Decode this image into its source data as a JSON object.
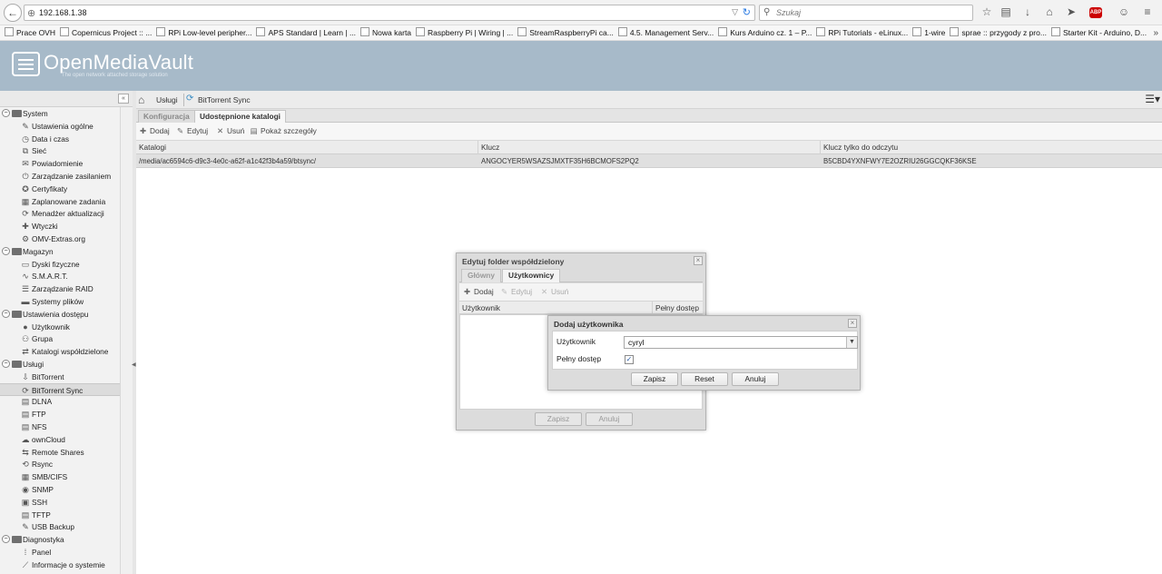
{
  "browser": {
    "url": "192.168.1.38",
    "search_placeholder": "Szukaj",
    "bookmarks": [
      "Prace OVH",
      "Copernicus Project :: ...",
      "RPi Low-level peripher...",
      "APS Standard | Learn | ...",
      "Nowa karta",
      "Raspberry Pi | Wiring | ...",
      "StreamRaspberryPi ca...",
      "4.5. Management Serv...",
      "Kurs Arduino cz. 1 – P...",
      "RPi Tutorials - eLinux...",
      "1-wire",
      "sprae :: przygody z pro...",
      "Starter Kit - Arduino, D..."
    ],
    "abp_label": "ABP"
  },
  "app": {
    "name": "OpenMediaVault",
    "tagline": "The open network attached storage solution"
  },
  "sidebar": {
    "collapse_glyph": "«",
    "nodes": [
      {
        "type": "group",
        "label": "System",
        "icon": "folder-icon"
      },
      {
        "type": "item",
        "label": "Ustawienia ogólne",
        "icon": "wrench-icon",
        "glyph": "✎"
      },
      {
        "type": "item",
        "label": "Data i czas",
        "icon": "clock-icon",
        "glyph": "◷"
      },
      {
        "type": "item",
        "label": "Sieć",
        "icon": "network-icon",
        "glyph": "⧉"
      },
      {
        "type": "item",
        "label": "Powiadomienie",
        "icon": "mail-icon",
        "glyph": "✉"
      },
      {
        "type": "item",
        "label": "Zarządzanie zasilaniem",
        "icon": "power-icon",
        "glyph": "⏻"
      },
      {
        "type": "item",
        "label": "Certyfikaty",
        "icon": "certificate-icon",
        "glyph": "✪"
      },
      {
        "type": "item",
        "label": "Zaplanowane zadania",
        "icon": "calendar-icon",
        "glyph": "▦"
      },
      {
        "type": "item",
        "label": "Menadżer aktualizacji",
        "icon": "update-icon",
        "glyph": "⟳"
      },
      {
        "type": "item",
        "label": "Wtyczki",
        "icon": "plugin-icon",
        "glyph": "✚"
      },
      {
        "type": "item",
        "label": "OMV-Extras.org",
        "icon": "extras-icon",
        "glyph": "⚙"
      },
      {
        "type": "group",
        "label": "Magazyn",
        "icon": "folder-icon"
      },
      {
        "type": "item",
        "label": "Dyski fizyczne",
        "icon": "disk-icon",
        "glyph": "▭"
      },
      {
        "type": "item",
        "label": "S.M.A.R.T.",
        "icon": "smart-icon",
        "glyph": "∿"
      },
      {
        "type": "item",
        "label": "Zarządzanie RAID",
        "icon": "raid-icon",
        "glyph": "☰"
      },
      {
        "type": "item",
        "label": "Systemy plików",
        "icon": "filesystem-icon",
        "glyph": "▬"
      },
      {
        "type": "group",
        "label": "Ustawienia dostępu",
        "icon": "folder-icon"
      },
      {
        "type": "item",
        "label": "Użytkownik",
        "icon": "user-icon",
        "glyph": "●"
      },
      {
        "type": "item",
        "label": "Grupa",
        "icon": "group-icon",
        "glyph": "⚇"
      },
      {
        "type": "item",
        "label": "Katalogi współdzielone",
        "icon": "share-icon",
        "glyph": "⇄"
      },
      {
        "type": "group",
        "label": "Usługi",
        "icon": "folder-icon"
      },
      {
        "type": "item",
        "label": "BitTorrent",
        "icon": "bittorrent-icon",
        "glyph": "⇩"
      },
      {
        "type": "item",
        "label": "BitTorrent Sync",
        "icon": "sync-icon",
        "glyph": "⟳",
        "selected": true
      },
      {
        "type": "item",
        "label": "DLNA",
        "icon": "dlna-icon",
        "glyph": "▤"
      },
      {
        "type": "item",
        "label": "FTP",
        "icon": "ftp-icon",
        "glyph": "▤"
      },
      {
        "type": "item",
        "label": "NFS",
        "icon": "nfs-icon",
        "glyph": "▤"
      },
      {
        "type": "item",
        "label": "ownCloud",
        "icon": "cloud-icon",
        "glyph": "☁"
      },
      {
        "type": "item",
        "label": "Remote Shares",
        "icon": "remote-icon",
        "glyph": "⇆"
      },
      {
        "type": "item",
        "label": "Rsync",
        "icon": "rsync-icon",
        "glyph": "⟲"
      },
      {
        "type": "item",
        "label": "SMB/CIFS",
        "icon": "smb-icon",
        "glyph": "▦"
      },
      {
        "type": "item",
        "label": "SNMP",
        "icon": "snmp-icon",
        "glyph": "◉"
      },
      {
        "type": "item",
        "label": "SSH",
        "icon": "ssh-icon",
        "glyph": "▣"
      },
      {
        "type": "item",
        "label": "TFTP",
        "icon": "tftp-icon",
        "glyph": "▤"
      },
      {
        "type": "item",
        "label": "USB Backup",
        "icon": "usb-icon",
        "glyph": "✎"
      },
      {
        "type": "group",
        "label": "Diagnostyka",
        "icon": "folder-icon"
      },
      {
        "type": "item",
        "label": "Panel",
        "icon": "dashboard-icon",
        "glyph": "⁞"
      },
      {
        "type": "item",
        "label": "Informacje o systemie",
        "icon": "chart-icon",
        "glyph": "⟋"
      }
    ]
  },
  "main": {
    "breadcrumb": [
      "Usługi",
      "BitTorrent Sync"
    ],
    "tabs": [
      {
        "label": "Konfiguracja",
        "active": false
      },
      {
        "label": "Udostępnione katalogi",
        "active": true
      }
    ],
    "toolbar": {
      "add": "Dodaj",
      "edit": "Edytuj",
      "delete": "Usuń",
      "details": "Pokaż szczegóły"
    },
    "grid": {
      "columns": [
        "Katalogi",
        "Klucz",
        "Klucz tylko do odczytu"
      ],
      "rows": [
        [
          "/media/ac6594c6-d9c3-4e0c-a62f-a1c42f3b4a59/btsync/",
          "ANGOCYER5WSAZSJMXTF35H6BCMOFS2PQ2",
          "B5CBD4YXNFWY7E2OZRIU26GGCQKF36KSE"
        ]
      ]
    }
  },
  "edit_window": {
    "title": "Edytuj folder współdzielony",
    "tabs": [
      {
        "label": "Główny",
        "active": false
      },
      {
        "label": "Użytkownicy",
        "active": true
      }
    ],
    "toolbar": {
      "add": "Dodaj",
      "edit": "Edytuj",
      "delete": "Usuń"
    },
    "columns": [
      "Użytkownik",
      "Pełny dostęp"
    ],
    "buttons": {
      "save": "Zapisz",
      "cancel": "Anuluj"
    }
  },
  "add_user_window": {
    "title": "Dodaj użytkownika",
    "user_label": "Użytkownik",
    "user_value": "cyryl",
    "full_access_label": "Pełny dostęp",
    "full_access_checked": true,
    "check_glyph": "✓",
    "buttons": {
      "save": "Zapisz",
      "reset": "Reset",
      "cancel": "Anuluj"
    }
  },
  "colors": {
    "header": "#a7bac9",
    "accent": "#3f8fc4"
  }
}
